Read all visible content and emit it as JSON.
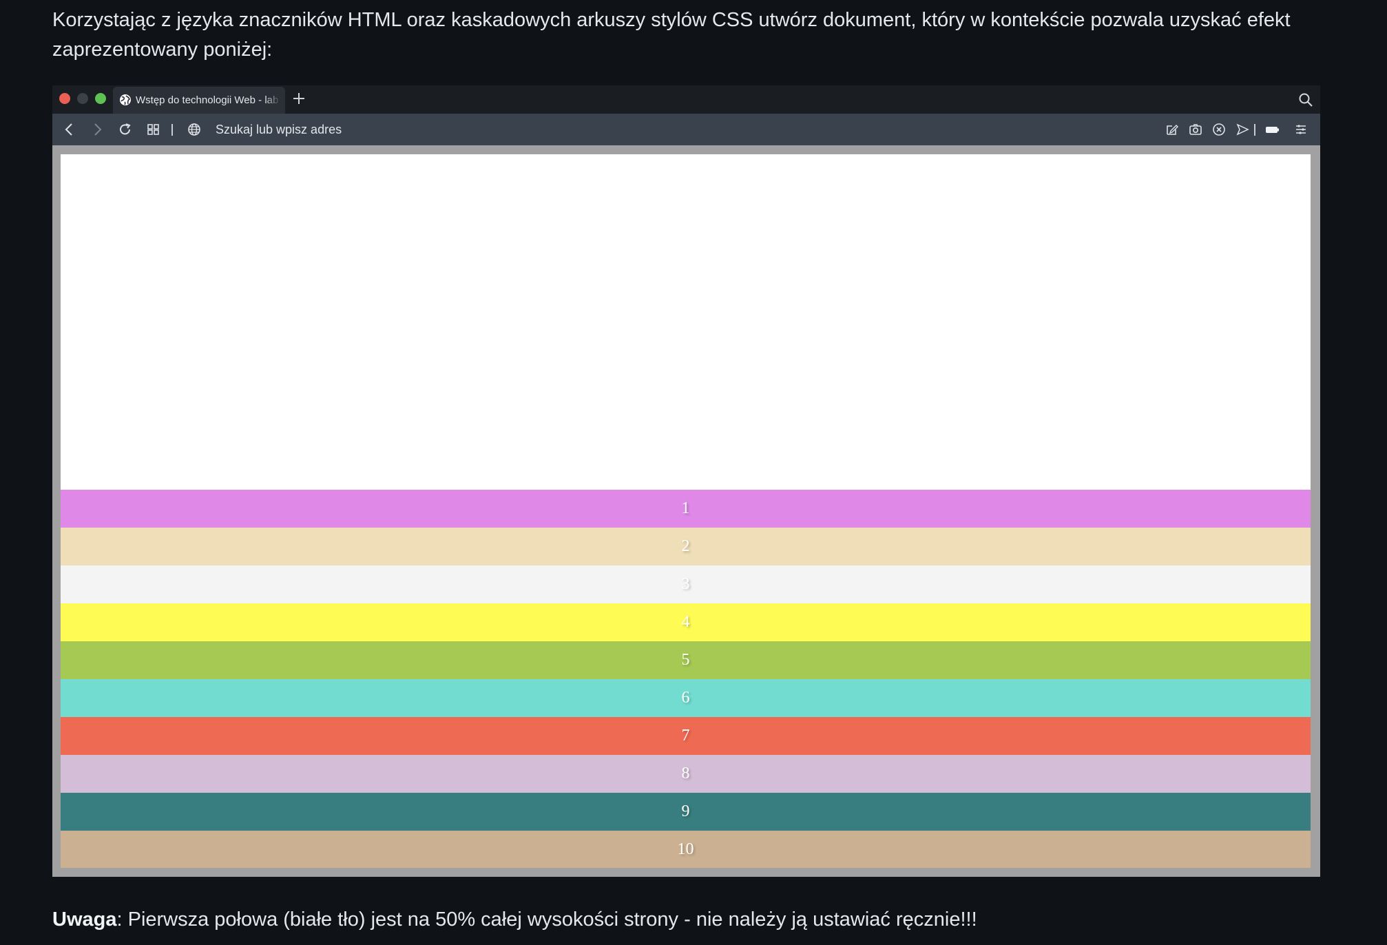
{
  "intro": {
    "text": "Korzystając z języka znaczników HTML oraz kaskadowych arkuszy stylów CSS utwórz dokument, który w kontekście pozwala uzyskać efekt zaprezentowany poniżej:"
  },
  "browser": {
    "tab": {
      "title": "Wstęp do technologii Web - lab",
      "icon": "globe-icon"
    },
    "new_tab_icon": "plus-icon",
    "search_icon": "search-icon",
    "toolbar": {
      "address_placeholder": "Szukaj lub wpisz adres",
      "icons": [
        "back-icon",
        "forward-icon",
        "reload-icon",
        "tiles-icon",
        "globe-icon",
        "edit-icon",
        "camera-icon",
        "block-icon",
        "send-icon",
        "battery-icon",
        "menu-icon"
      ]
    }
  },
  "page": {
    "bands": [
      {
        "label": "1",
        "color": "#df88e8"
      },
      {
        "label": "2",
        "color": "#efdeb7"
      },
      {
        "label": "3",
        "color": "#f4f4f4"
      },
      {
        "label": "4",
        "color": "#fefc54"
      },
      {
        "label": "5",
        "color": "#a5c952"
      },
      {
        "label": "6",
        "color": "#72dcd1"
      },
      {
        "label": "7",
        "color": "#ee6a53"
      },
      {
        "label": "8",
        "color": "#d4bdd6"
      },
      {
        "label": "9",
        "color": "#387e80"
      },
      {
        "label": "10",
        "color": "#cbb191"
      }
    ]
  },
  "note": {
    "bold": "Uwaga",
    "text": ": Pierwsza połowa (białe tło) jest na 50% całej wysokości strony - nie należy ją ustawiać ręcznie!!!"
  }
}
